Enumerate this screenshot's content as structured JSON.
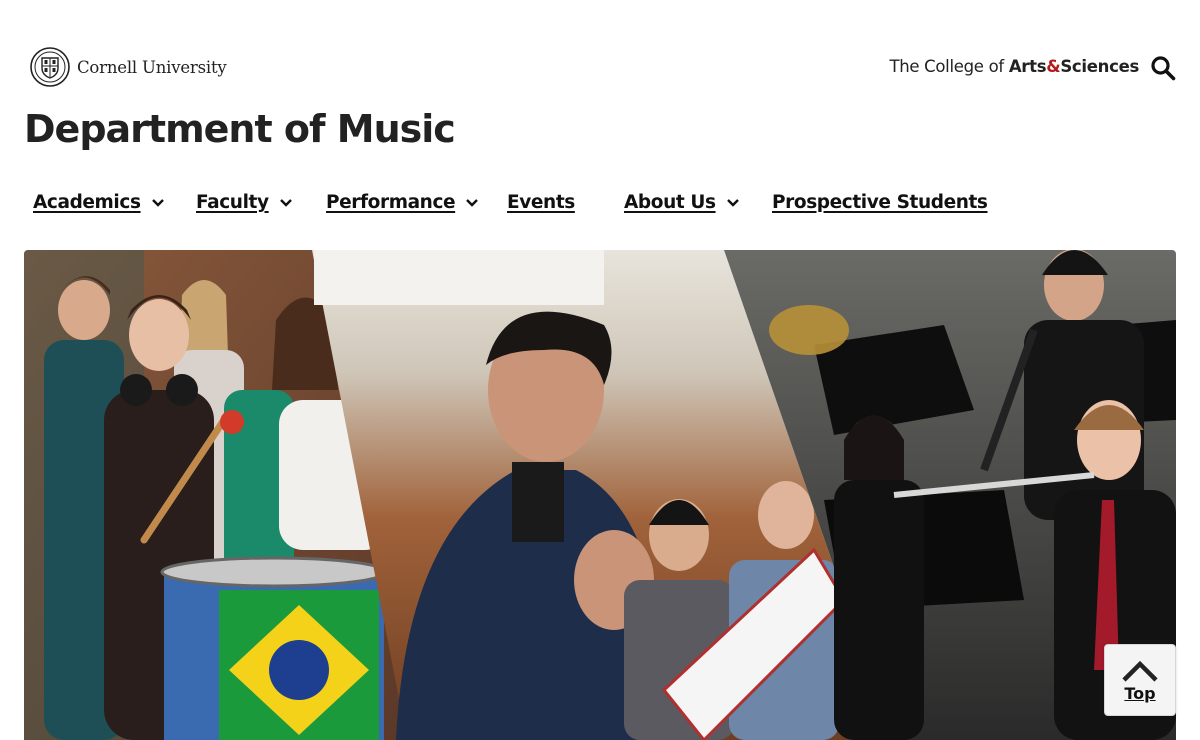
{
  "header": {
    "university_name": "Cornell University",
    "college": {
      "prefix": "The College of ",
      "part1": "Arts",
      "amp": "&",
      "part2": "Sciences"
    },
    "department": {
      "prefix": "Department of ",
      "name": "Music"
    }
  },
  "nav": {
    "items": [
      {
        "label": "Academics",
        "has_dropdown": true
      },
      {
        "label": "Faculty",
        "has_dropdown": true
      },
      {
        "label": "Performance",
        "has_dropdown": true
      },
      {
        "label": "Events",
        "has_dropdown": false
      },
      {
        "label": "About Us",
        "has_dropdown": true
      },
      {
        "label": "Prospective Students",
        "has_dropdown": false
      }
    ]
  },
  "back_to_top": {
    "label": "Top"
  },
  "icons": {
    "search": "search-icon",
    "chevron": "chevron-down-icon",
    "seal": "cornell-seal-icon",
    "top": "chevron-up-icon"
  },
  "colors": {
    "brand_red": "#b31b1b",
    "text": "#222222"
  }
}
